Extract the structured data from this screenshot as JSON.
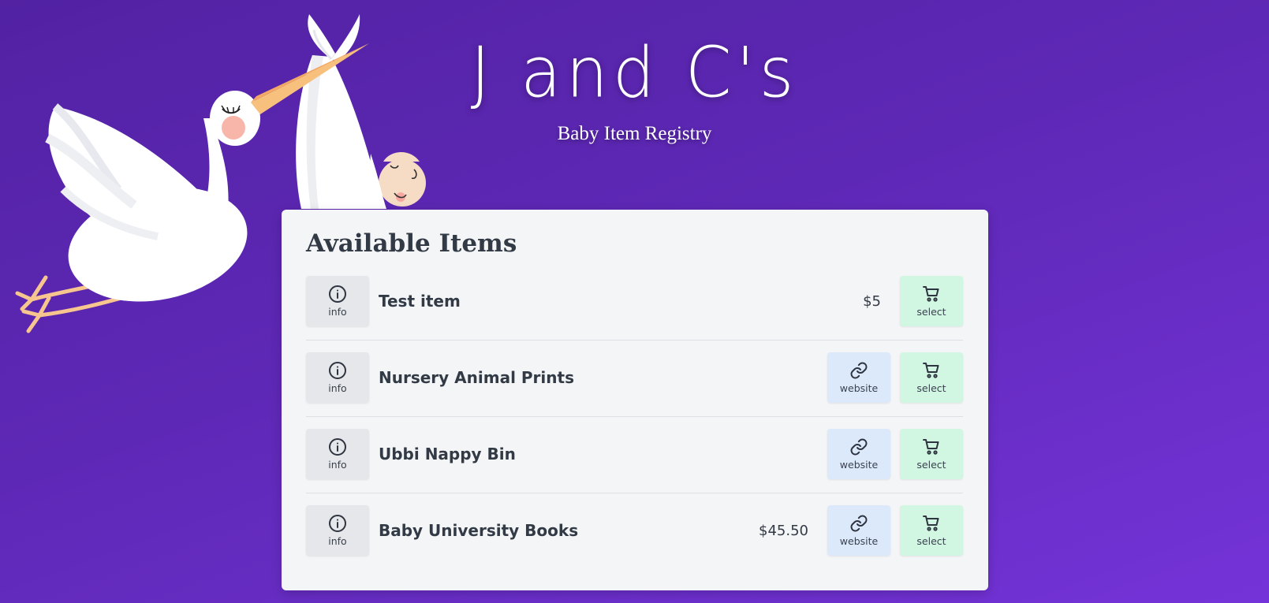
{
  "header": {
    "title": "J and C's",
    "subtitle": "Baby Item Registry"
  },
  "main": {
    "heading": "Available Items",
    "items": [
      {
        "name": "Test item",
        "price": "$5",
        "has_website": false,
        "info_label": "info",
        "website_label": "",
        "select_label": "select"
      },
      {
        "name": "Nursery Animal Prints",
        "price": "",
        "has_website": true,
        "info_label": "info",
        "website_label": "website",
        "select_label": "select"
      },
      {
        "name": "Ubbi Nappy Bin",
        "price": "",
        "has_website": true,
        "info_label": "info",
        "website_label": "website",
        "select_label": "select"
      },
      {
        "name": "Baby University Books",
        "price": "$45.50",
        "has_website": true,
        "info_label": "info",
        "website_label": "website",
        "select_label": "select"
      }
    ]
  },
  "icons": {
    "info": "info-circle-icon",
    "website": "link-icon",
    "select": "shopping-cart-icon",
    "illustration": "stork-with-baby-illustration"
  },
  "colors": {
    "background_start": "#5222a3",
    "background_end": "#7433d8",
    "card_background": "#f4f5f7",
    "info_button": "#e5e7ea",
    "website_button": "#dce9fb",
    "select_button": "#d1f6e1",
    "text_dark": "#323a46"
  }
}
